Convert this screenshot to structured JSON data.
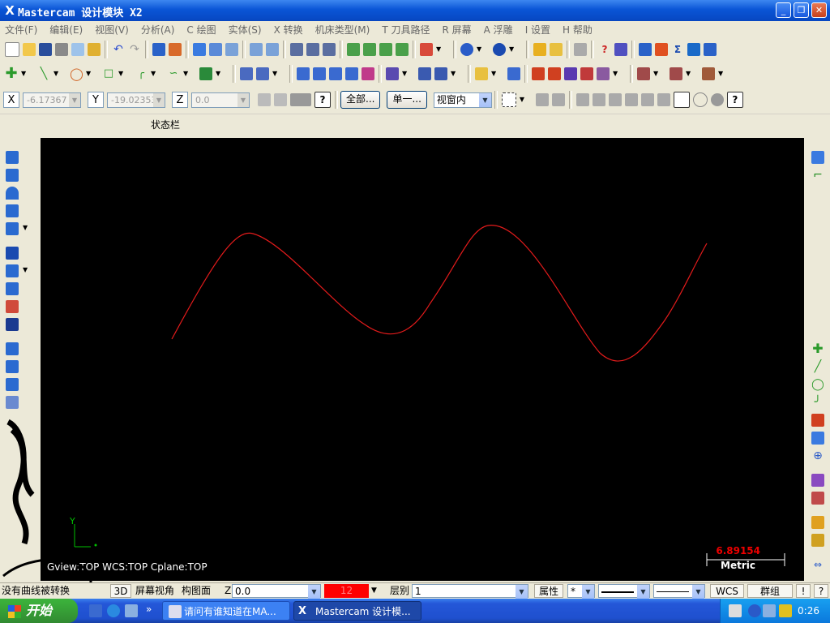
{
  "window": {
    "title": "Mastercam 设计模块  X2",
    "logo": "X",
    "min": "_",
    "max": "❐",
    "close": "✕"
  },
  "menu": [
    "文件(F)",
    "编辑(E)",
    "视图(V)",
    "分析(A)",
    "C 绘图",
    "实体(S)",
    "X 转换",
    "机床类型(M)",
    "T 刀具路径",
    "R 屏幕",
    "A 浮雕",
    "I 设置",
    "H 帮助"
  ],
  "coords": {
    "x_label": "X",
    "x_value": "-6.17367",
    "y_label": "Y",
    "y_value": "-19.02353",
    "z_label": "Z",
    "z_value": "0.0"
  },
  "toolbar3": {
    "all_button": "全部...",
    "single_button": "单一...",
    "view_select": "视窗内",
    "help": "?"
  },
  "status_label": "状态栏",
  "viewport": {
    "view_info": "Gview:TOP   WCS:TOP   Cplane:TOP",
    "axis_y": "Y",
    "scale_value": "6.89154",
    "scale_unit": "Metric"
  },
  "bottom_bar": {
    "message": "没有曲线被转换",
    "btn_3d": "3D",
    "screen_view": "屏幕视角",
    "cplane": "构图面",
    "z_label": "Z",
    "z_value": "0.0",
    "color_value": "12",
    "level_label": "层别",
    "level_value": "1",
    "attributes": "属性",
    "point_style": "*",
    "wcs": "WCS",
    "group": "群组",
    "help": "!",
    "help2": "?"
  },
  "taskbar": {
    "start": "开始",
    "task1": "请问有谁知道在MA...",
    "task2": "Mastercam 设计模...",
    "clock": "0:26",
    "quick_more": "»"
  },
  "colors": {
    "curve": "#e31b1b",
    "viewport_bg": "#000000",
    "color_swatch": "#ff0000"
  }
}
